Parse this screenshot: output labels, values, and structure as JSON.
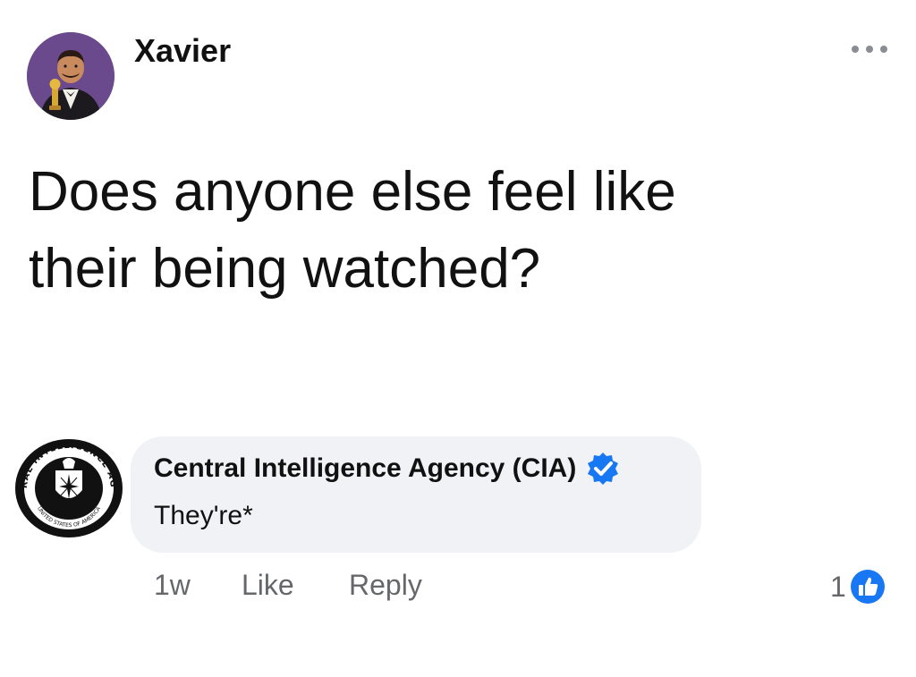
{
  "post": {
    "author": "Xavier",
    "text_line1": "Does anyone else feel like",
    "text_line2": "their being watched?",
    "more_icon": "more-dots-icon"
  },
  "comment": {
    "author": "Central Intelligence Agency (CIA)",
    "verified_icon": "verified-badge-icon",
    "text": "They're*",
    "seal_text_top": "CENTRAL INTELLIGENCE AGENCY",
    "seal_text_bottom": "UNITED STATES OF AMERICA",
    "time": "1w",
    "like_label": "Like",
    "reply_label": "Reply",
    "reaction_count": "1",
    "reaction_icon": "like-reaction-icon"
  },
  "colors": {
    "bubble": "#f0f2f5",
    "brand_blue": "#1877f2",
    "meta_gray": "#65676b",
    "avatar_bg": "#6a4a8c"
  }
}
